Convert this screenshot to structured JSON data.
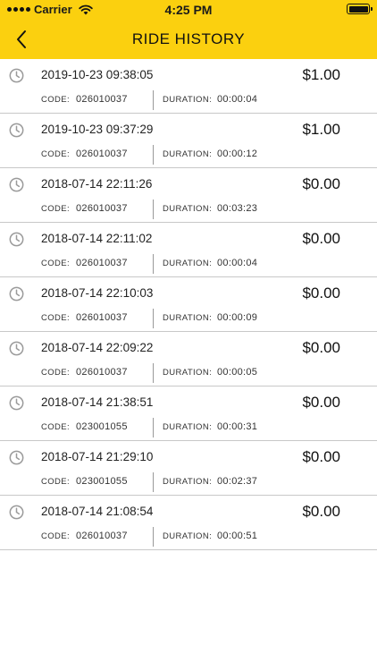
{
  "status_bar": {
    "carrier": "Carrier",
    "time": "4:25 PM"
  },
  "header": {
    "title": "RIDE HISTORY",
    "back_icon": "chevron-left-icon"
  },
  "colors": {
    "accent": "#fbd00f",
    "divider": "#c8c8c8",
    "icon": "#9a9a9a"
  },
  "rides": [
    {
      "datetime": "2019-10-23 09:38:05",
      "amount": "$1.00",
      "code_label": "CODE:",
      "code": "026010037",
      "duration_label": "DURATION:",
      "duration": "00:00:04"
    },
    {
      "datetime": "2019-10-23 09:37:29",
      "amount": "$1.00",
      "code_label": "CODE:",
      "code": "026010037",
      "duration_label": "DURATION:",
      "duration": "00:00:12"
    },
    {
      "datetime": "2018-07-14 22:11:26",
      "amount": "$0.00",
      "code_label": "CODE:",
      "code": "026010037",
      "duration_label": "DURATION:",
      "duration": "00:03:23"
    },
    {
      "datetime": "2018-07-14 22:11:02",
      "amount": "$0.00",
      "code_label": "CODE:",
      "code": "026010037",
      "duration_label": "DURATION:",
      "duration": "00:00:04"
    },
    {
      "datetime": "2018-07-14 22:10:03",
      "amount": "$0.00",
      "code_label": "CODE:",
      "code": "026010037",
      "duration_label": "DURATION:",
      "duration": "00:00:09"
    },
    {
      "datetime": "2018-07-14 22:09:22",
      "amount": "$0.00",
      "code_label": "CODE:",
      "code": "026010037",
      "duration_label": "DURATION:",
      "duration": "00:00:05"
    },
    {
      "datetime": "2018-07-14 21:38:51",
      "amount": "$0.00",
      "code_label": "CODE:",
      "code": "023001055",
      "duration_label": "DURATION:",
      "duration": "00:00:31"
    },
    {
      "datetime": "2018-07-14 21:29:10",
      "amount": "$0.00",
      "code_label": "CODE:",
      "code": "023001055",
      "duration_label": "DURATION:",
      "duration": "00:02:37"
    },
    {
      "datetime": "2018-07-14 21:08:54",
      "amount": "$0.00",
      "code_label": "CODE:",
      "code": "026010037",
      "duration_label": "DURATION:",
      "duration": "00:00:51"
    }
  ]
}
